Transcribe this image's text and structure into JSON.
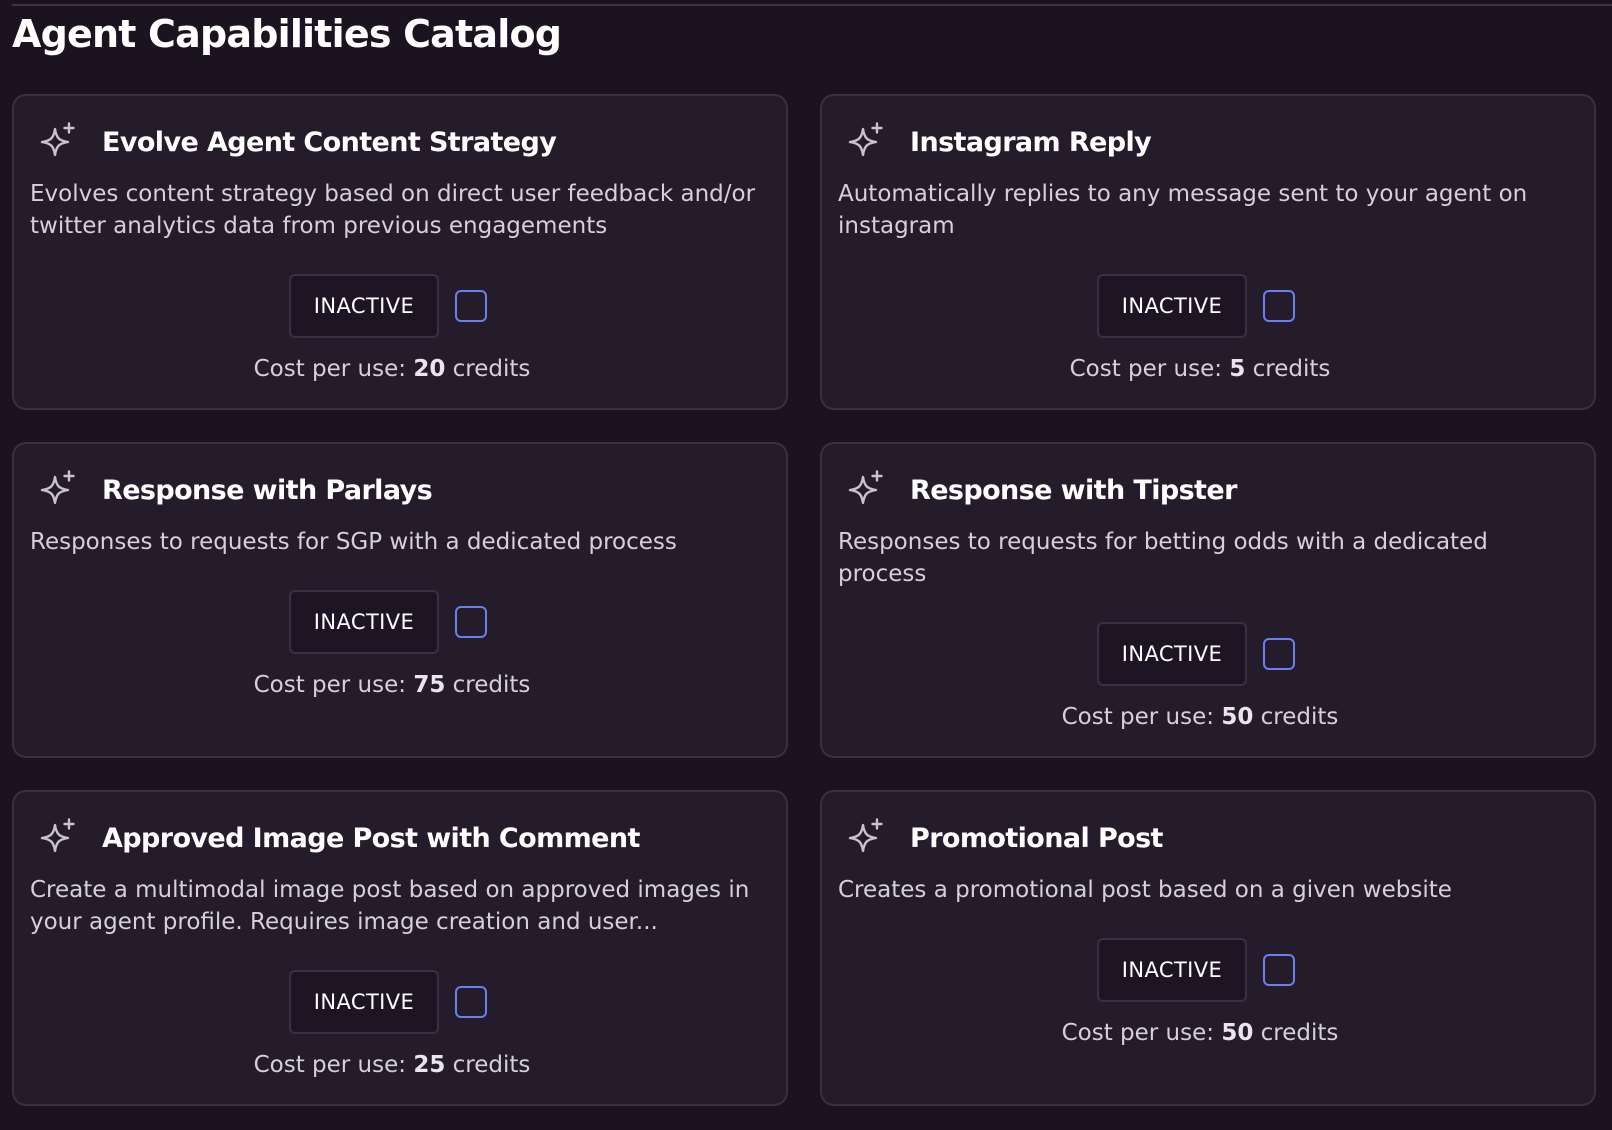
{
  "page": {
    "title": "Agent Capabilities Catalog"
  },
  "labels": {
    "cost_prefix": "Cost per use:",
    "cost_suffix": "credits"
  },
  "colors": {
    "background": "#1b1420",
    "card": "#241c2b",
    "border": "#3a3042",
    "checkbox_accent": "#6b7fee"
  },
  "icons": {
    "card_icon": "sparkle-icon"
  },
  "capabilities": [
    {
      "title": "Evolve Agent Content Strategy",
      "description": "Evolves content strategy based on direct user feedback and/or twitter analytics data from previous engagements",
      "status": "INACTIVE",
      "checked": false,
      "cost": "20"
    },
    {
      "title": "Instagram Reply",
      "description": "Automatically replies to any message sent to your agent on instagram",
      "status": "INACTIVE",
      "checked": false,
      "cost": "5"
    },
    {
      "title": "Response with Parlays",
      "description": "Responses to requests for SGP with a dedicated process",
      "status": "INACTIVE",
      "checked": false,
      "cost": "75"
    },
    {
      "title": "Response with Tipster",
      "description": "Responses to requests for betting odds with a dedicated process",
      "status": "INACTIVE",
      "checked": false,
      "cost": "50"
    },
    {
      "title": "Approved Image Post with Comment",
      "description": "Create a multimodal image post based on approved images in your agent profile. Requires image creation and user...",
      "status": "INACTIVE",
      "checked": false,
      "cost": "25"
    },
    {
      "title": "Promotional Post",
      "description": "Creates a promotional post based on a given website",
      "status": "INACTIVE",
      "checked": false,
      "cost": "50"
    }
  ]
}
